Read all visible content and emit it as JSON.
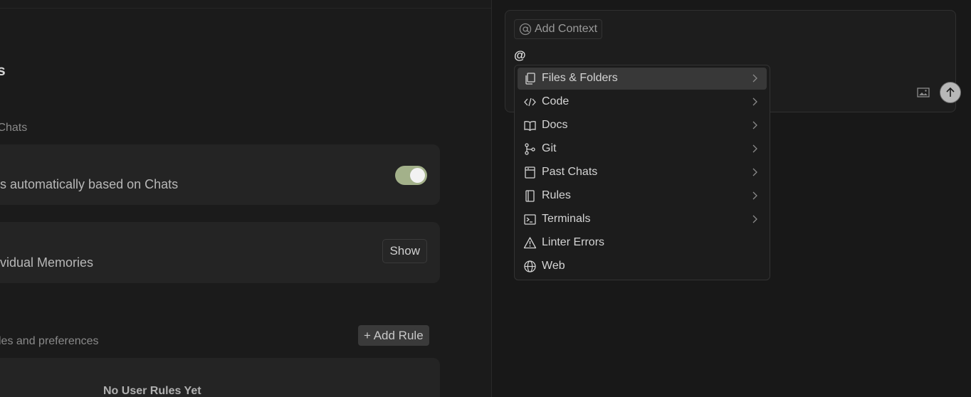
{
  "settings": {
    "section_title": "s",
    "section_desc": "ss Chats",
    "auto_memories_label": "s automatically based on Chats",
    "memories_label": "vidual Memories",
    "show_label": "Show",
    "rules_desc": "r rules and preferences",
    "add_rule_label": "+ Add Rule",
    "empty_rules_title": "No User Rules Yet",
    "auto_memories_enabled": true
  },
  "chat": {
    "add_context_label": "Add Context",
    "input_value": "@"
  },
  "context_menu": {
    "items": [
      {
        "label": "Files & Folders",
        "icon": "files-icon",
        "has_submenu": true,
        "active": true
      },
      {
        "label": "Code",
        "icon": "code-icon",
        "has_submenu": true
      },
      {
        "label": "Docs",
        "icon": "book-icon",
        "has_submenu": true
      },
      {
        "label": "Git",
        "icon": "git-branch-icon",
        "has_submenu": true
      },
      {
        "label": "Past Chats",
        "icon": "past-chats-icon",
        "has_submenu": true
      },
      {
        "label": "Rules",
        "icon": "rules-icon",
        "has_submenu": true
      },
      {
        "label": "Terminals",
        "icon": "terminal-icon",
        "has_submenu": true
      },
      {
        "label": "Linter Errors",
        "icon": "warning-icon",
        "has_submenu": false
      },
      {
        "label": "Web",
        "icon": "globe-icon",
        "has_submenu": false
      }
    ]
  },
  "colors": {
    "toggle_on": "#a3b18a",
    "menu_active": "#383838"
  }
}
